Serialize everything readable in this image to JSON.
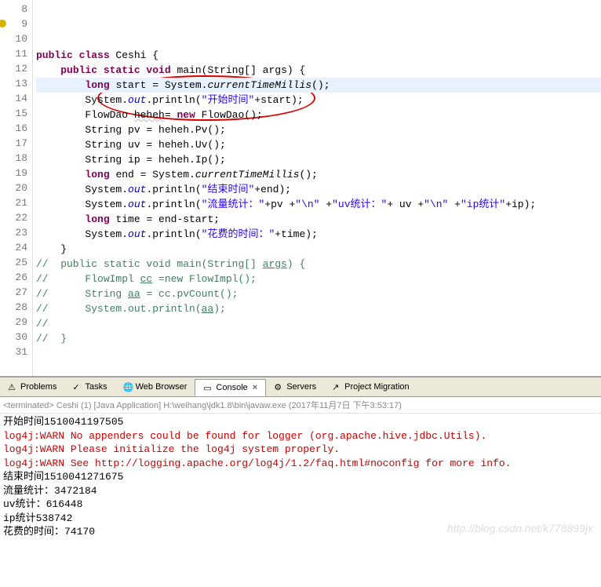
{
  "editor": {
    "lines": [
      {
        "num": "8",
        "html": "<span class='kw'>public class</span> Ceshi {"
      },
      {
        "num": "9",
        "html": "    <span class='kw'>public static void</span> main(String[] args) {",
        "marker": "warn"
      },
      {
        "num": "10",
        "html": "        <span class='kw'>long</span> start = System.<span class='mth'>currentTimeMillis</span>();",
        "hl": true
      },
      {
        "num": "11",
        "html": "        System.<span class='fld'>out</span>.println(<span class='str'>\"开始时间\"</span>+start);"
      },
      {
        "num": "12",
        "html": "        FlowDao <span class='err'>heheh</span>= <span class='kw'>new</span> FlowDao();"
      },
      {
        "num": "13",
        "html": "        String pv = heheh.Pv();"
      },
      {
        "num": "14",
        "html": "        String uv = heheh.Uv();"
      },
      {
        "num": "15",
        "html": "        String ip = heheh.Ip();"
      },
      {
        "num": "16",
        "html": "        <span class='kw'>long</span> end = System.<span class='mth'>currentTimeMillis</span>();"
      },
      {
        "num": "17",
        "html": "        System.<span class='fld'>out</span>.println(<span class='str'>\"结束时间\"</span>+end);"
      },
      {
        "num": "18",
        "html": "        System.<span class='fld'>out</span>.println(<span class='str'>\"流量统计：\"</span>+pv +<span class='str'>\"\\n\"</span> +<span class='str'>\"uv统计：\"</span>+ uv +<span class='str'>\"\\n\"</span> +<span class='str'>\"ip统计\"</span>+ip);"
      },
      {
        "num": "19",
        "html": "        <span class='kw'>long</span> time = end-start;"
      },
      {
        "num": "20",
        "html": "        System.<span class='fld'>out</span>.println(<span class='str'>\"花费的时间：\"</span>+time);"
      },
      {
        "num": "21",
        "html": "    }"
      },
      {
        "num": "22",
        "html": "<span class='com'>//  public static void main(String[] <span style='text-decoration:underline'>args</span>) {</span>"
      },
      {
        "num": "23",
        "html": "<span class='com'>//      FlowImpl <span style='text-decoration:underline'>cc</span> =new FlowImpl();</span>"
      },
      {
        "num": "24",
        "html": "<span class='com'>//      String <span style='text-decoration:underline'>aa</span> = cc.pvCount();</span>"
      },
      {
        "num": "25",
        "html": "<span class='com'>//      System.out.println(<span style='text-decoration:underline'>aa</span>);</span>"
      },
      {
        "num": "26",
        "html": "<span class='com'>//</span>"
      },
      {
        "num": "27",
        "html": "<span class='com'>//  }</span>"
      },
      {
        "num": "28",
        "html": ""
      },
      {
        "num": "29",
        "html": ""
      },
      {
        "num": "30",
        "html": "}"
      },
      {
        "num": "31",
        "html": ""
      }
    ]
  },
  "tabs": [
    {
      "label": "Problems"
    },
    {
      "label": "Tasks"
    },
    {
      "label": "Web Browser"
    },
    {
      "label": "Console",
      "active": true
    },
    {
      "label": "Servers"
    },
    {
      "label": "Project Migration"
    }
  ],
  "console": {
    "header": "<terminated> Ceshi (1) [Java Application] H:\\weihang\\jdk1.8\\bin\\javaw.exe (2017年11月7日 下午3:53:17)",
    "lines": [
      {
        "text": "开始时间1510041197505"
      },
      {
        "text": "log4j:WARN No appenders could be found for logger (org.apache.hive.jdbc.Utils).",
        "warn": true
      },
      {
        "text": "log4j:WARN Please initialize the log4j system properly.",
        "warn": true
      },
      {
        "text": "log4j:WARN See http://logging.apache.org/log4j/1.2/faq.html#noconfig for more info.",
        "warn": true
      },
      {
        "text": "结束时间1510041271675"
      },
      {
        "text": "流量统计：3472184"
      },
      {
        "text": "uv统计：616448"
      },
      {
        "text": "ip统计538742"
      },
      {
        "text": "花费的时间：74170"
      }
    ]
  },
  "watermark": "http://blog.csdn.net/k778899jx"
}
